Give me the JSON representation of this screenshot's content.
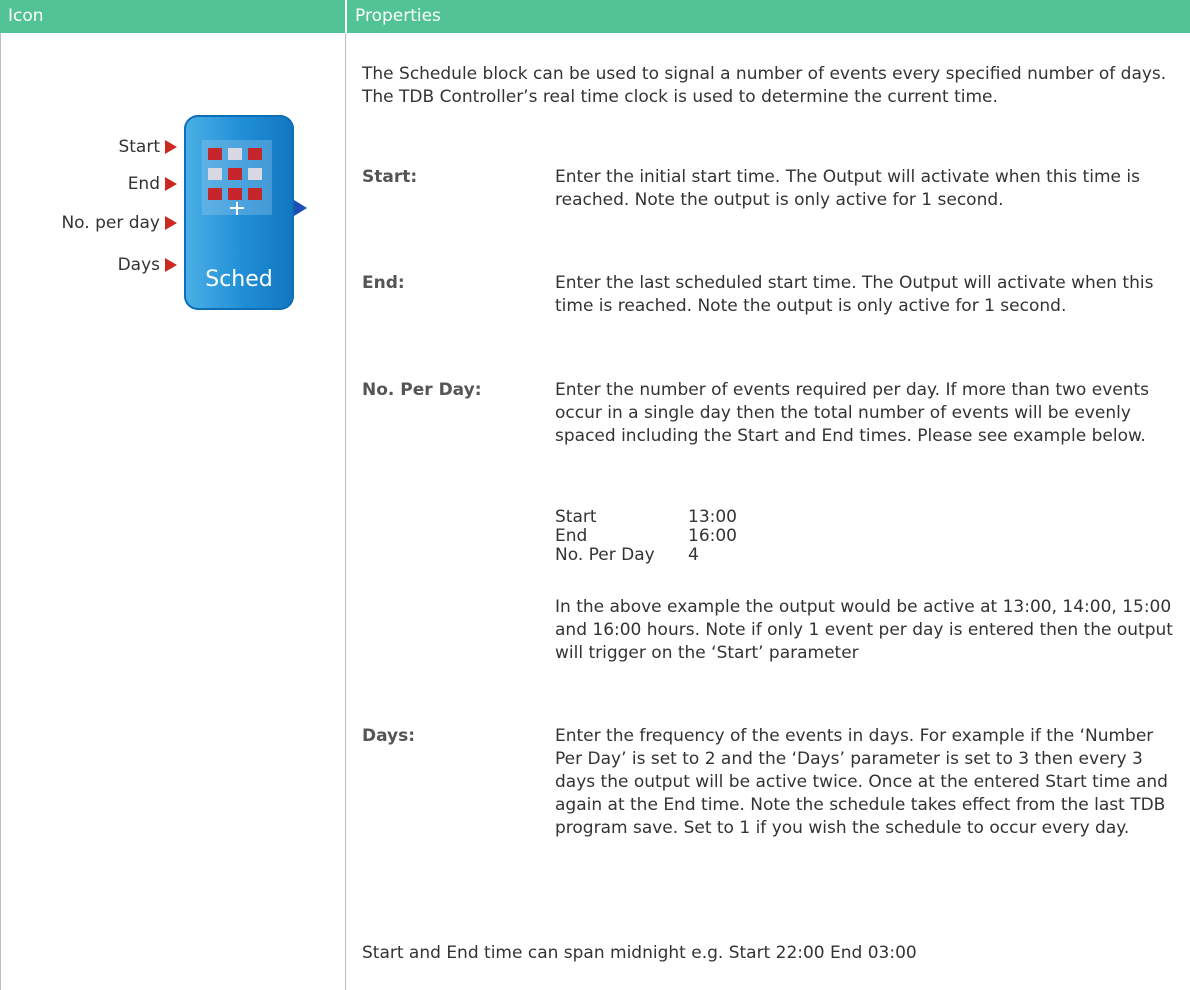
{
  "header": {
    "icon_col": "Icon",
    "properties_col": "Properties"
  },
  "block": {
    "ports": [
      "Start",
      "End",
      "No. per day",
      "Days"
    ],
    "label": "Sched",
    "port_color": "#cc2a20",
    "block_color": "#1f8ed6"
  },
  "intro": "The Schedule block can be used to signal a number of events every specified number of days. The TDB Controller’s real time clock is used to determine the current time.",
  "params": {
    "start": {
      "label": "Start:",
      "text": "Enter the initial start time. The Output will activate when this time is reached. Note the output is only active for 1 second."
    },
    "end": {
      "label": "End:",
      "text": "Enter the last scheduled start time. The Output will activate when this time is reached. Note the output is only active for 1 second."
    },
    "noperday": {
      "label": "No. Per Day:",
      "text": "Enter the number of events required per day.  If more than two events occur in a single day then the total number of events will be evenly spaced including the Start and End times. Please see example below."
    },
    "days": {
      "label": "Days:",
      "text": "Enter the frequency of the events in days. For example if the ‘Number Per Day’ is set to 2 and the ‘Days’ parameter is set to 3 then every 3 days the output will be active twice. Once at the entered Start time and again at the End time. Note the schedule takes effect from the last TDB program save.  Set to 1 if you wish the schedule to occur every day."
    }
  },
  "example": {
    "rows": [
      {
        "key": "Start",
        "value": "13:00"
      },
      {
        "key": "End",
        "value": "16:00"
      },
      {
        "key": "No. Per Day",
        "value": "4"
      }
    ],
    "note": "In the above example the output would be active at 13:00, 14:00, 15:00 and 16:00 hours. Note if only 1 event per day is entered then the output will trigger on the ‘Start’ parameter"
  },
  "footer": "Start and End time can span midnight e.g. Start 22:00 End 03:00",
  "colors": {
    "header_bg": "#52c395",
    "header_text": "#ffffff"
  }
}
